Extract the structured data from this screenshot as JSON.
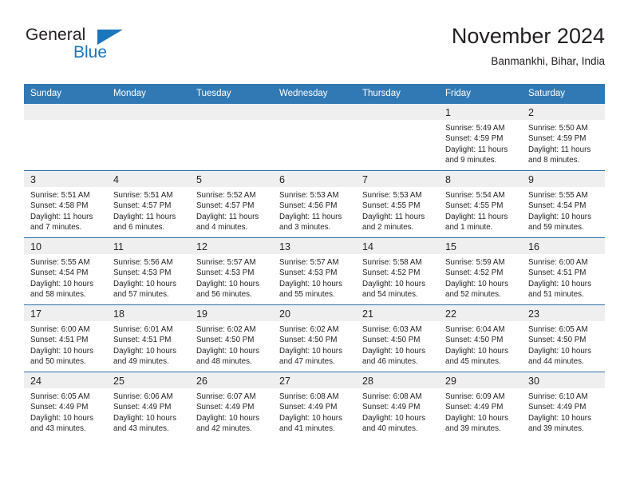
{
  "brand": {
    "name_top": "General",
    "name_bottom": "Blue",
    "triangle_color": "#1b76bc"
  },
  "header": {
    "title": "November 2024",
    "subtitle": "Banmankhi, Bihar, India"
  },
  "theme": {
    "header_blue": "#3079b4",
    "day_band_gray": "#efefef",
    "text": "#231f20"
  },
  "weekdays": [
    "Sunday",
    "Monday",
    "Tuesday",
    "Wednesday",
    "Thursday",
    "Friday",
    "Saturday"
  ],
  "weeks": [
    [
      {
        "empty": true
      },
      {
        "empty": true
      },
      {
        "empty": true
      },
      {
        "empty": true
      },
      {
        "empty": true
      },
      {
        "day": "1",
        "sunrise": "Sunrise: 5:49 AM",
        "sunset": "Sunset: 4:59 PM",
        "daylight": "Daylight: 11 hours and 9 minutes."
      },
      {
        "day": "2",
        "sunrise": "Sunrise: 5:50 AM",
        "sunset": "Sunset: 4:59 PM",
        "daylight": "Daylight: 11 hours and 8 minutes."
      }
    ],
    [
      {
        "day": "3",
        "sunrise": "Sunrise: 5:51 AM",
        "sunset": "Sunset: 4:58 PM",
        "daylight": "Daylight: 11 hours and 7 minutes."
      },
      {
        "day": "4",
        "sunrise": "Sunrise: 5:51 AM",
        "sunset": "Sunset: 4:57 PM",
        "daylight": "Daylight: 11 hours and 6 minutes."
      },
      {
        "day": "5",
        "sunrise": "Sunrise: 5:52 AM",
        "sunset": "Sunset: 4:57 PM",
        "daylight": "Daylight: 11 hours and 4 minutes."
      },
      {
        "day": "6",
        "sunrise": "Sunrise: 5:53 AM",
        "sunset": "Sunset: 4:56 PM",
        "daylight": "Daylight: 11 hours and 3 minutes."
      },
      {
        "day": "7",
        "sunrise": "Sunrise: 5:53 AM",
        "sunset": "Sunset: 4:55 PM",
        "daylight": "Daylight: 11 hours and 2 minutes."
      },
      {
        "day": "8",
        "sunrise": "Sunrise: 5:54 AM",
        "sunset": "Sunset: 4:55 PM",
        "daylight": "Daylight: 11 hours and 1 minute."
      },
      {
        "day": "9",
        "sunrise": "Sunrise: 5:55 AM",
        "sunset": "Sunset: 4:54 PM",
        "daylight": "Daylight: 10 hours and 59 minutes."
      }
    ],
    [
      {
        "day": "10",
        "sunrise": "Sunrise: 5:55 AM",
        "sunset": "Sunset: 4:54 PM",
        "daylight": "Daylight: 10 hours and 58 minutes."
      },
      {
        "day": "11",
        "sunrise": "Sunrise: 5:56 AM",
        "sunset": "Sunset: 4:53 PM",
        "daylight": "Daylight: 10 hours and 57 minutes."
      },
      {
        "day": "12",
        "sunrise": "Sunrise: 5:57 AM",
        "sunset": "Sunset: 4:53 PM",
        "daylight": "Daylight: 10 hours and 56 minutes."
      },
      {
        "day": "13",
        "sunrise": "Sunrise: 5:57 AM",
        "sunset": "Sunset: 4:53 PM",
        "daylight": "Daylight: 10 hours and 55 minutes."
      },
      {
        "day": "14",
        "sunrise": "Sunrise: 5:58 AM",
        "sunset": "Sunset: 4:52 PM",
        "daylight": "Daylight: 10 hours and 54 minutes."
      },
      {
        "day": "15",
        "sunrise": "Sunrise: 5:59 AM",
        "sunset": "Sunset: 4:52 PM",
        "daylight": "Daylight: 10 hours and 52 minutes."
      },
      {
        "day": "16",
        "sunrise": "Sunrise: 6:00 AM",
        "sunset": "Sunset: 4:51 PM",
        "daylight": "Daylight: 10 hours and 51 minutes."
      }
    ],
    [
      {
        "day": "17",
        "sunrise": "Sunrise: 6:00 AM",
        "sunset": "Sunset: 4:51 PM",
        "daylight": "Daylight: 10 hours and 50 minutes."
      },
      {
        "day": "18",
        "sunrise": "Sunrise: 6:01 AM",
        "sunset": "Sunset: 4:51 PM",
        "daylight": "Daylight: 10 hours and 49 minutes."
      },
      {
        "day": "19",
        "sunrise": "Sunrise: 6:02 AM",
        "sunset": "Sunset: 4:50 PM",
        "daylight": "Daylight: 10 hours and 48 minutes."
      },
      {
        "day": "20",
        "sunrise": "Sunrise: 6:02 AM",
        "sunset": "Sunset: 4:50 PM",
        "daylight": "Daylight: 10 hours and 47 minutes."
      },
      {
        "day": "21",
        "sunrise": "Sunrise: 6:03 AM",
        "sunset": "Sunset: 4:50 PM",
        "daylight": "Daylight: 10 hours and 46 minutes."
      },
      {
        "day": "22",
        "sunrise": "Sunrise: 6:04 AM",
        "sunset": "Sunset: 4:50 PM",
        "daylight": "Daylight: 10 hours and 45 minutes."
      },
      {
        "day": "23",
        "sunrise": "Sunrise: 6:05 AM",
        "sunset": "Sunset: 4:50 PM",
        "daylight": "Daylight: 10 hours and 44 minutes."
      }
    ],
    [
      {
        "day": "24",
        "sunrise": "Sunrise: 6:05 AM",
        "sunset": "Sunset: 4:49 PM",
        "daylight": "Daylight: 10 hours and 43 minutes."
      },
      {
        "day": "25",
        "sunrise": "Sunrise: 6:06 AM",
        "sunset": "Sunset: 4:49 PM",
        "daylight": "Daylight: 10 hours and 43 minutes."
      },
      {
        "day": "26",
        "sunrise": "Sunrise: 6:07 AM",
        "sunset": "Sunset: 4:49 PM",
        "daylight": "Daylight: 10 hours and 42 minutes."
      },
      {
        "day": "27",
        "sunrise": "Sunrise: 6:08 AM",
        "sunset": "Sunset: 4:49 PM",
        "daylight": "Daylight: 10 hours and 41 minutes."
      },
      {
        "day": "28",
        "sunrise": "Sunrise: 6:08 AM",
        "sunset": "Sunset: 4:49 PM",
        "daylight": "Daylight: 10 hours and 40 minutes."
      },
      {
        "day": "29",
        "sunrise": "Sunrise: 6:09 AM",
        "sunset": "Sunset: 4:49 PM",
        "daylight": "Daylight: 10 hours and 39 minutes."
      },
      {
        "day": "30",
        "sunrise": "Sunrise: 6:10 AM",
        "sunset": "Sunset: 4:49 PM",
        "daylight": "Daylight: 10 hours and 39 minutes."
      }
    ]
  ]
}
